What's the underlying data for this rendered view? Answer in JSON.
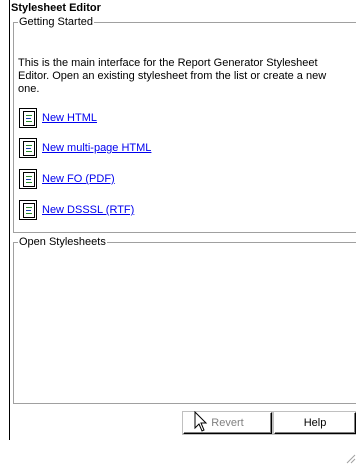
{
  "editor": {
    "title": "Stylesheet Editor"
  },
  "getting_started": {
    "legend": "Getting Started",
    "intro": "This is the main interface for the Report Generator Stylesheet Editor.  Open an existing stylesheet from the list or create a new one.",
    "links": [
      {
        "label": "New HTML",
        "icon": "document-icon"
      },
      {
        "label": "New multi-page HTML",
        "icon": "document-icon"
      },
      {
        "label": "New FO (PDF)",
        "icon": "document-icon"
      },
      {
        "label": "New DSSSL (RTF)",
        "icon": "document-icon"
      }
    ]
  },
  "open_stylesheets": {
    "legend": "Open Stylesheets",
    "items": []
  },
  "buttons": {
    "revert": "Revert",
    "help": "Help"
  },
  "colors": {
    "link": "#0000ee",
    "disabled_text": "#808080"
  }
}
